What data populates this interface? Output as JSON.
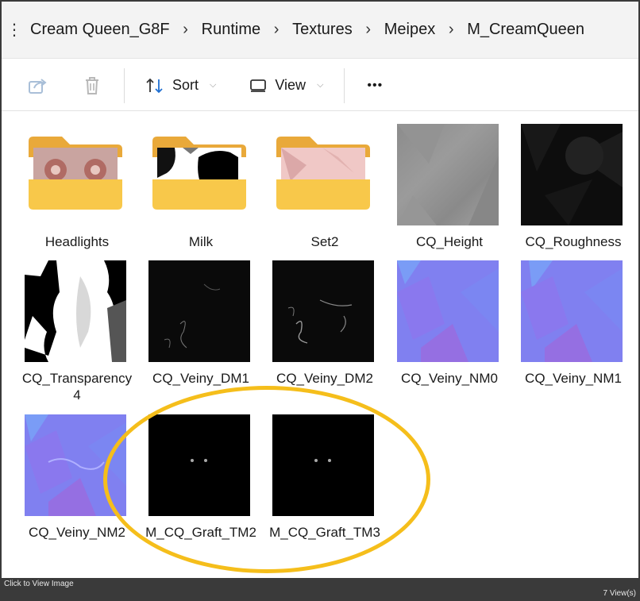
{
  "breadcrumb": {
    "items": [
      "Cream Queen_G8F",
      "Runtime",
      "Textures",
      "Meipex",
      "M_CreamQueen"
    ]
  },
  "toolbar": {
    "sort_label": "Sort",
    "view_label": "View",
    "more_label": "•••"
  },
  "files": [
    {
      "name": "Headlights",
      "kind": "folder"
    },
    {
      "name": "Milk",
      "kind": "folder"
    },
    {
      "name": "Set2",
      "kind": "folder"
    },
    {
      "name": "CQ_Height",
      "kind": "image"
    },
    {
      "name": "CQ_Roughness",
      "kind": "image"
    },
    {
      "name": "CQ_Transparency4",
      "kind": "image"
    },
    {
      "name": "CQ_Veiny_DM1",
      "kind": "image"
    },
    {
      "name": "CQ_Veiny_DM2",
      "kind": "image"
    },
    {
      "name": "CQ_Veiny_NM0",
      "kind": "image"
    },
    {
      "name": "CQ_Veiny_NM1",
      "kind": "image"
    },
    {
      "name": "CQ_Veiny_NM2",
      "kind": "image"
    },
    {
      "name": "M_CQ_Graft_TM2",
      "kind": "image"
    },
    {
      "name": "M_CQ_Graft_TM3",
      "kind": "image"
    }
  ],
  "labels": {
    "transparency_line1": "CQ_Transparency",
    "transparency_line2": "4"
  },
  "status": {
    "left": "Click to View Image",
    "right": "7 View(s)"
  },
  "colors": {
    "highlight": "#f5be1b",
    "folder": "#f8c84a",
    "normal_map": "#8080ff"
  }
}
